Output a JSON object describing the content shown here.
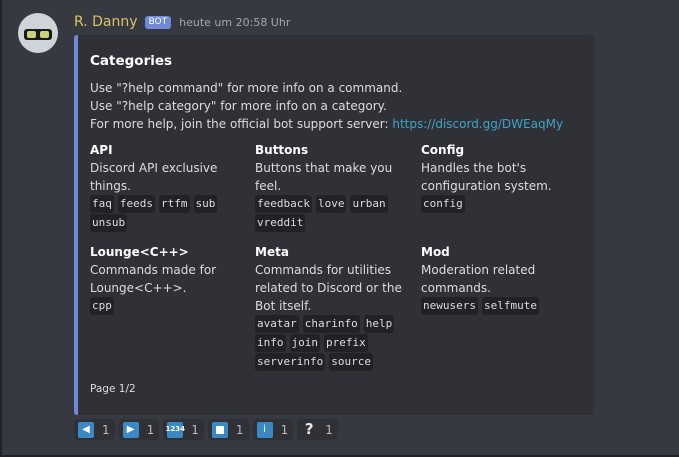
{
  "message": {
    "author": "R. Danny",
    "badge": "BOT",
    "timestamp": "heute um 20:58 Uhr"
  },
  "embed": {
    "title": "Categories",
    "description": [
      "Use \"?help command\" for more info on a command.",
      "Use \"?help category\" for more info on a category."
    ],
    "support_prefix": "For more help, join the official bot support server: ",
    "support_link": "https://discord.gg/DWEaqMy",
    "fields": [
      {
        "name": "API",
        "value": "Discord API exclusive things.",
        "commands": [
          "faq",
          "feeds",
          "rtfm",
          "sub",
          "unsub"
        ]
      },
      {
        "name": "Buttons",
        "value": "Buttons that make you feel.",
        "commands": [
          "feedback",
          "love",
          "urban",
          "vreddit"
        ]
      },
      {
        "name": "Config",
        "value": "Handles the bot's configuration system.",
        "commands": [
          "config"
        ]
      },
      {
        "name": "Lounge<C++>",
        "value": "Commands made for Lounge<C++>.",
        "commands": [
          "cpp"
        ]
      },
      {
        "name": "Meta",
        "value": "Commands for utilities related to Discord or the Bot itself.",
        "commands": [
          "avatar",
          "charinfo",
          "help",
          "info",
          "join",
          "prefix",
          "serverinfo",
          "source"
        ]
      },
      {
        "name": "Mod",
        "value": "Moderation related commands.",
        "commands": [
          "newusers",
          "selfmute"
        ]
      }
    ],
    "footer": "Page 1/2"
  },
  "reactions": [
    {
      "icon": "arrow-backward-icon",
      "glyph": "◀",
      "count": "1"
    },
    {
      "icon": "arrow-forward-icon",
      "glyph": "▶",
      "count": "1"
    },
    {
      "icon": "input-numbers-icon",
      "glyph": "1234",
      "count": "1"
    },
    {
      "icon": "stop-button-icon",
      "glyph": "■",
      "count": "1"
    },
    {
      "icon": "information-icon",
      "glyph": "i",
      "count": "1"
    },
    {
      "icon": "question-mark-icon",
      "glyph": "?",
      "count": "1"
    }
  ]
}
